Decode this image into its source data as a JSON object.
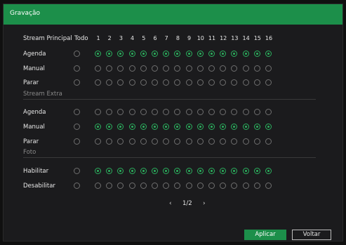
{
  "window": {
    "title": "Gravação"
  },
  "header": {
    "stream_label": "Stream Principal",
    "todo_label": "Todo",
    "channels": [
      "1",
      "2",
      "3",
      "4",
      "5",
      "6",
      "7",
      "8",
      "9",
      "10",
      "11",
      "12",
      "13",
      "14",
      "15",
      "16"
    ]
  },
  "main_stream": {
    "rows": [
      {
        "label": "Agenda",
        "todo": false,
        "selected": true
      },
      {
        "label": "Manual",
        "todo": false,
        "selected": false
      },
      {
        "label": "Parar",
        "todo": false,
        "selected": false
      }
    ]
  },
  "extra_stream": {
    "title": "Stream Extra",
    "rows": [
      {
        "label": "Agenda",
        "todo": false,
        "selected": false
      },
      {
        "label": "Manual",
        "todo": false,
        "selected": true
      },
      {
        "label": "Parar",
        "todo": false,
        "selected": false
      }
    ]
  },
  "photo": {
    "title": "Foto",
    "rows": [
      {
        "label": "Habilitar",
        "todo": false,
        "selected": true
      },
      {
        "label": "Desabilitar",
        "todo": false,
        "selected": false
      }
    ]
  },
  "pager": {
    "prev": "‹",
    "page": "1/2",
    "next": "›"
  },
  "buttons": {
    "apply": "Aplicar",
    "back": "Voltar"
  },
  "colors": {
    "accent": "#1c8f4a",
    "radio_on": "#2bb05e",
    "radio_off": "#6f6f6f"
  }
}
